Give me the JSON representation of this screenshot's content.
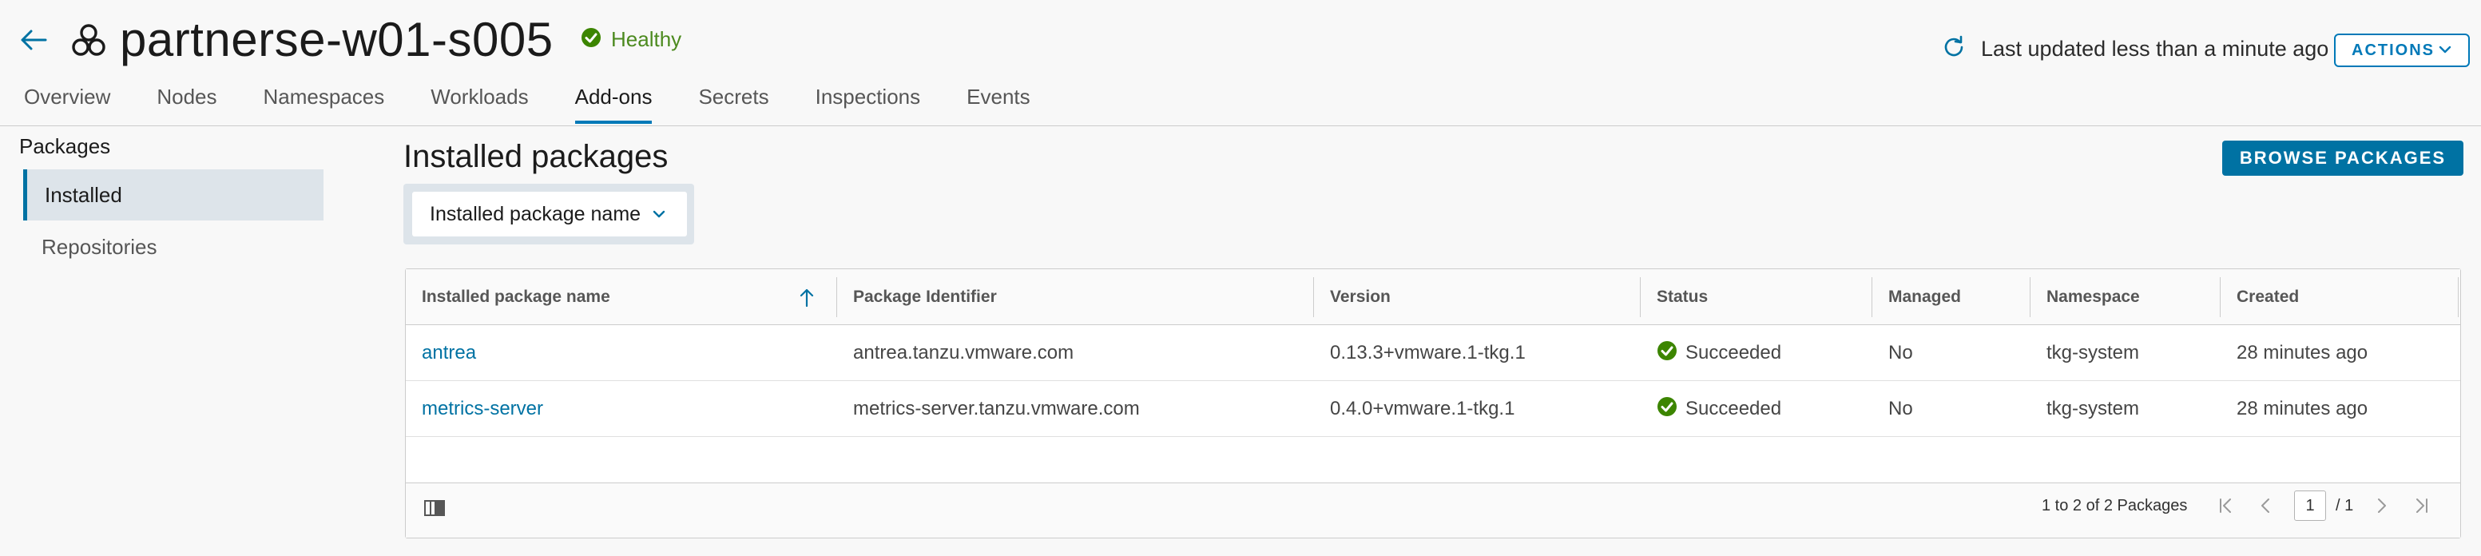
{
  "header": {
    "title": "partnerse-w01-s005",
    "health": "Healthy",
    "last_updated": "Last updated less than a minute ago",
    "actions_label": "ACTIONS"
  },
  "tabs": [
    {
      "label": "Overview"
    },
    {
      "label": "Nodes"
    },
    {
      "label": "Namespaces"
    },
    {
      "label": "Workloads"
    },
    {
      "label": "Add-ons",
      "active": true
    },
    {
      "label": "Secrets"
    },
    {
      "label": "Inspections"
    },
    {
      "label": "Events"
    }
  ],
  "sidebar": {
    "heading": "Packages",
    "items": [
      {
        "label": "Installed",
        "selected": true
      },
      {
        "label": "Repositories"
      }
    ]
  },
  "main": {
    "title": "Installed packages",
    "browse_label": "BROWSE PACKAGES",
    "filter_label": "Installed package name"
  },
  "table": {
    "columns": [
      "Installed package name",
      "Package Identifier",
      "Version",
      "Status",
      "Managed",
      "Namespace",
      "Created"
    ],
    "rows": [
      [
        "antrea",
        "antrea.tanzu.vmware.com",
        "0.13.3+vmware.1-tkg.1",
        "Succeeded",
        "No",
        "tkg-system",
        "28 minutes ago"
      ],
      [
        "metrics-server",
        "metrics-server.tanzu.vmware.com",
        "0.4.0+vmware.1-tkg.1",
        "Succeeded",
        "No",
        "tkg-system",
        "28 minutes ago"
      ]
    ],
    "footer": {
      "range_text": "1 to 2 of 2 Packages",
      "page": "1",
      "total_pages": "/ 1"
    }
  },
  "colors": {
    "accent": "#0072a3",
    "success": "#3c8500",
    "selected_bg": "#dde4ea"
  }
}
